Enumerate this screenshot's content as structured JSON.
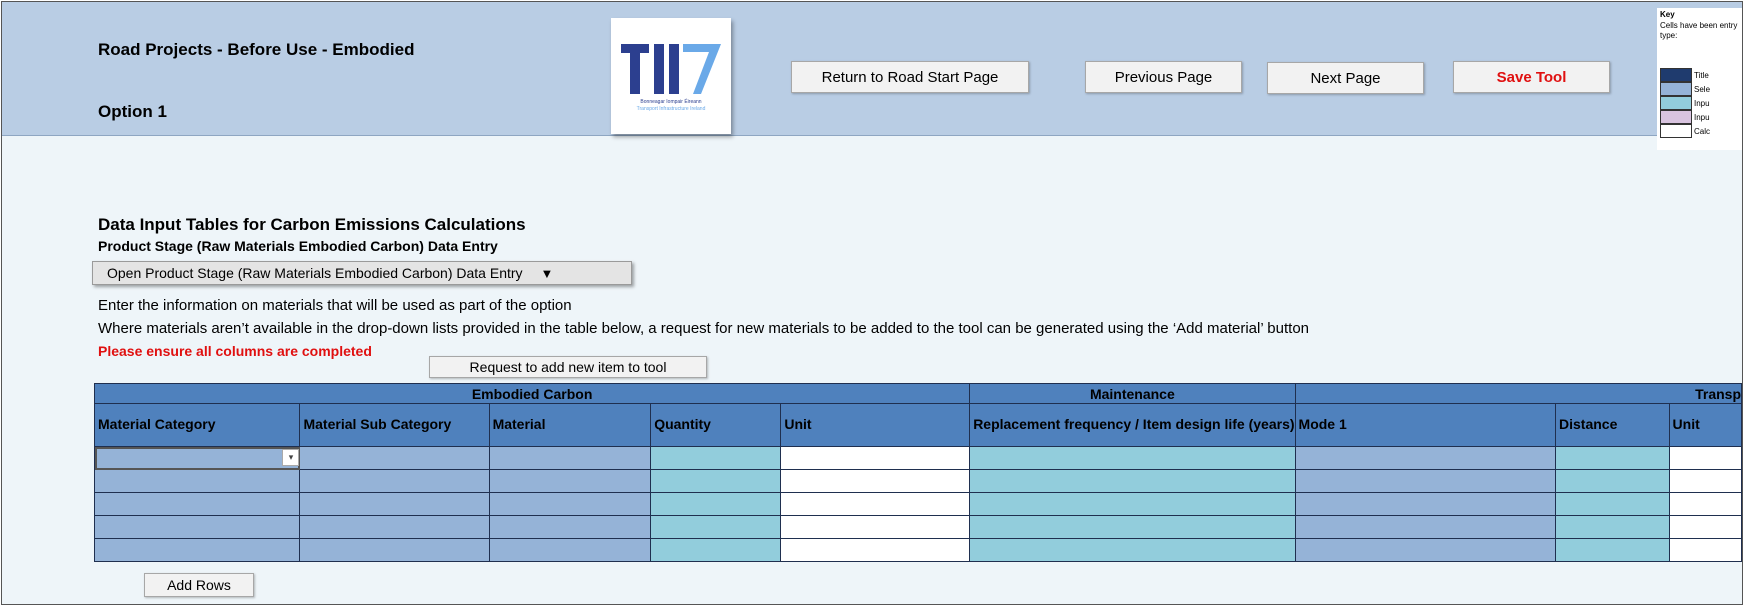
{
  "header": {
    "title": "Road Projects - Before Use - Embodied",
    "option": "Option 1",
    "logo": {
      "text1": "Bonneagar Iompair Éireann",
      "text2": "Transport Infrastructure Ireland"
    }
  },
  "nav": {
    "return_label": "Return to Road Start Page",
    "previous_label": "Previous Page",
    "next_label": "Next Page",
    "save_label": "Save Tool"
  },
  "key": {
    "title": "Key",
    "desc": "Cells have been entry type:",
    "items": [
      {
        "label": "Title",
        "color": "#1f3b6e"
      },
      {
        "label": "Sele",
        "color": "#95b3d7"
      },
      {
        "label": "Inpu",
        "color": "#92cddc"
      },
      {
        "label": "Inpu",
        "color": "#d9c4e0"
      },
      {
        "label": "Calc",
        "color": "#ffffff"
      }
    ]
  },
  "content": {
    "section_title": "Data Input Tables for Carbon Emissions Calculations",
    "subsection_title": "Product Stage (Raw Materials Embodied Carbon) Data Entry",
    "dropdown_label": "Open Product Stage (Raw Materials Embodied Carbon) Data Entry",
    "instruction1": "Enter the information on materials that will be used as part of the option",
    "instruction2": "Where materials aren’t available in the drop-down lists provided in the table below, a request for new materials to be added to the tool can be generated using the ‘Add material’ button",
    "warning": "Please ensure all columns are completed",
    "request_button": "Request to add new item to tool",
    "add_rows_button": "Add Rows"
  },
  "table": {
    "groups": [
      "Embodied Carbon",
      "Maintenance",
      "Transp"
    ],
    "columns": [
      "Material Category",
      "Material Sub Category",
      "Material",
      "Quantity",
      "Unit",
      "Replacement frequency / Item design life (years)",
      "Mode 1",
      "Distance",
      "Unit"
    ]
  },
  "colors": {
    "header_band": "#b9cde4",
    "table_header": "#4f81bd",
    "select_cell": "#95b3d7",
    "input_cell": "#92cddc",
    "warning": "#e01010"
  }
}
